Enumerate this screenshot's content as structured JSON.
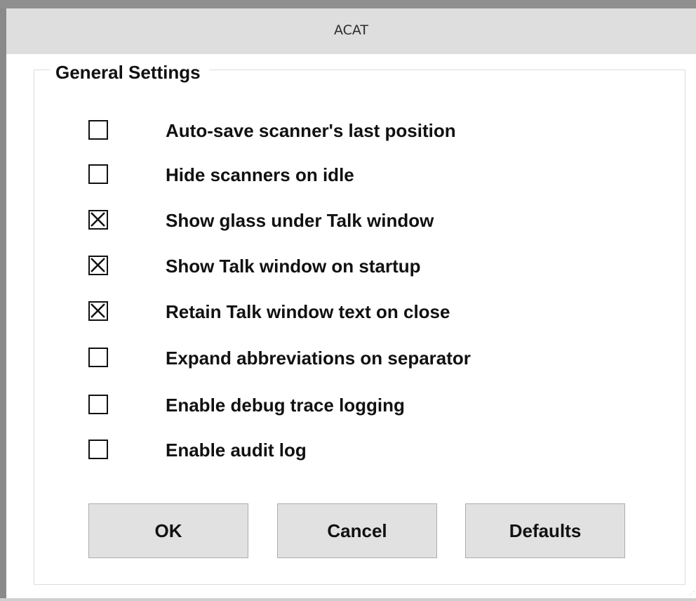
{
  "window": {
    "title": "ACAT"
  },
  "group": {
    "title": "General Settings"
  },
  "options": [
    {
      "label": "Auto-save scanner's last position",
      "checked": false
    },
    {
      "label": "Hide scanners on idle",
      "checked": false
    },
    {
      "label": "Show glass under Talk window",
      "checked": true
    },
    {
      "label": "Show Talk window on startup",
      "checked": true
    },
    {
      "label": "Retain Talk window text on close",
      "checked": true
    },
    {
      "label": "Expand abbreviations on separator",
      "checked": false
    },
    {
      "label": "Enable debug trace logging",
      "checked": false
    },
    {
      "label": "Enable audit log",
      "checked": false
    }
  ],
  "buttons": {
    "ok": "OK",
    "cancel": "Cancel",
    "defaults": "Defaults"
  },
  "colors": {
    "titlebar": "#dedede",
    "button_face": "#e1e1e1",
    "text": "#111111"
  }
}
